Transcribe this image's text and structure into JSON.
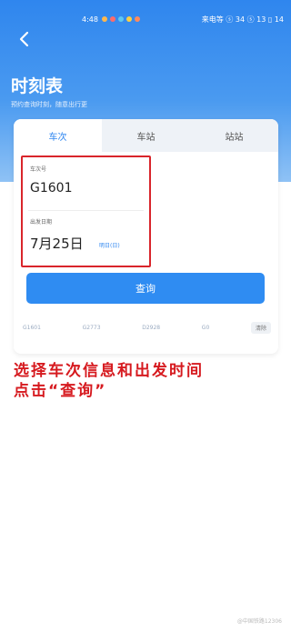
{
  "status_bar": {
    "time": "4:48",
    "right_text": "来电等 ⓢ 34 ⓢ 13 ▯ 14",
    "dot_colors": [
      "#ffb84d",
      "#ff6b6b",
      "#5ec8f0",
      "#ffcf40",
      "#ff8a5c"
    ]
  },
  "header": {
    "title": "时刻表",
    "subtitle": "预约查询时刻，随意出行更"
  },
  "tabs": [
    {
      "label": "车次",
      "active": true
    },
    {
      "label": "车站",
      "active": false
    },
    {
      "label": "站站",
      "active": false
    }
  ],
  "form": {
    "train_label": "车次号",
    "train_value": "G1601",
    "date_label": "出发日期",
    "date_value": "7月25日",
    "date_tag": "明日(日)"
  },
  "query_button": "查询",
  "history": [
    "G1601",
    "G2773",
    "D2928",
    "G0",
    "清除"
  ],
  "caption": {
    "line1": "选择车次信息和出发时间",
    "line2": "点击“查询”"
  },
  "watermark": "@中国铁路12306",
  "colors": {
    "accent": "#2f8cf2",
    "highlight": "#d9252b",
    "caption": "#d61a1f"
  }
}
